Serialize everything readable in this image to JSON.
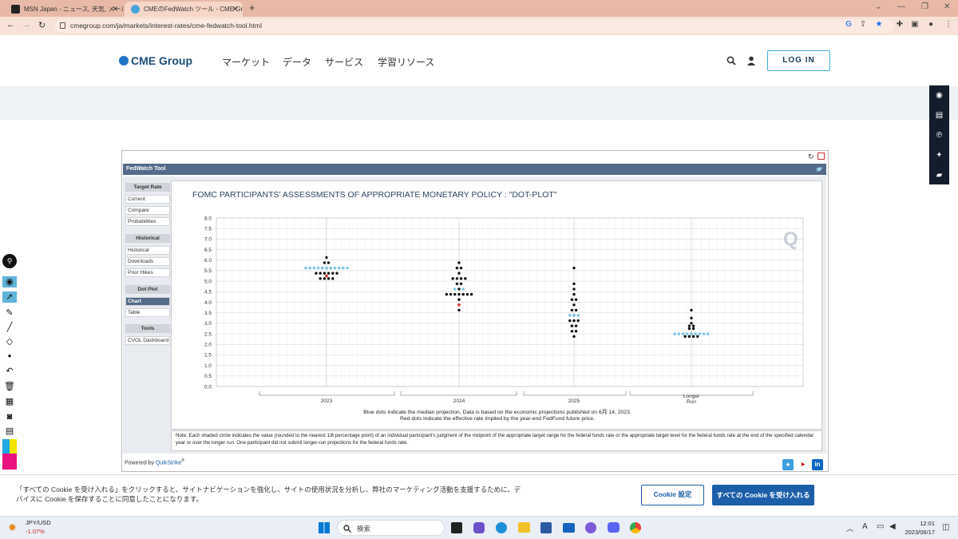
{
  "browser": {
    "tabs": [
      {
        "title": "MSN Japan - ニュース, 天気, メール（"
      },
      {
        "title": "CMEのFedWatch ツール - CME Gro"
      }
    ],
    "new_tab": "+",
    "url": "cmegroup.com/ja/markets/interest-rates/cme-fedwatch-tool.html"
  },
  "site": {
    "logo": "CME Group",
    "nav": [
      "マーケット",
      "データ",
      "サービス",
      "学習リソース"
    ],
    "login": "LOG IN"
  },
  "tool": {
    "header": "FedWatch Tool",
    "sidebar": {
      "target_rate": {
        "heading": "Target Rate",
        "items": [
          "Current",
          "Compare",
          "Probabilities"
        ]
      },
      "historical": {
        "heading": "Historical",
        "items": [
          "Historical",
          "Downloads",
          "Prior Hikes"
        ]
      },
      "dot_plot": {
        "heading": "Dot Plot",
        "items": [
          "Chart",
          "Table"
        ]
      },
      "tools": {
        "heading": "Tools",
        "items": [
          "CVOL Dashboard"
        ]
      }
    },
    "powered_by": "Powered by",
    "powered_brand": "QuikStrike",
    "powered_reg": "®",
    "note": "Note: Each shaded circle indicates the value (rounded to the nearest 1/8 percentage point) of an individual participant's judgment of the midpoint of the appropriate target range for the federal funds rate or the appropriate target level for the federal funds rate at the end of the specified calendar year or over the longer run. One participant did not submit longer-run projections for the federal funds rate."
  },
  "chart_data": {
    "type": "scatter",
    "title": "FOMC PARTICIPANTS' ASSESSMENTS OF APPROPRIATE MONETARY POLICY : \"DOT-PLOT\"",
    "categories": [
      "2023",
      "2024",
      "2025",
      "Longer Run"
    ],
    "y_ticks": [
      "8.0",
      "7.5",
      "7.0",
      "6.5",
      "6.0",
      "5.5",
      "5.0",
      "4.5",
      "4.0",
      "3.5",
      "3.0",
      "2.5",
      "2.0",
      "1.5",
      "1.0",
      "0.5",
      "0.0"
    ],
    "ylim": [
      0,
      8
    ],
    "grid": true,
    "caption_line1": "Blue dots indicate the median projection. Data is based on the economic projections published on 6月 14, 2023.",
    "caption_line2": "Red dots indicate the effective rate implied by the year-end FedFund future price.",
    "colors": {
      "participant": "#111111",
      "median": "#7ec7e3",
      "effective": "#d9342b"
    },
    "participants": [
      {
        "category": "2023",
        "dots": [
          [
            6.125,
            1
          ],
          [
            5.875,
            2
          ],
          [
            5.625,
            3
          ],
          [
            5.375,
            6
          ],
          [
            5.125,
            4
          ]
        ]
      },
      {
        "category": "2024",
        "dots": [
          [
            5.875,
            1
          ],
          [
            5.625,
            2
          ],
          [
            5.375,
            1
          ],
          [
            5.125,
            4
          ],
          [
            4.875,
            2
          ],
          [
            4.625,
            1
          ],
          [
            4.375,
            7
          ],
          [
            4.125,
            1
          ],
          [
            3.875,
            1
          ],
          [
            3.625,
            1
          ]
        ]
      },
      {
        "category": "2025",
        "dots": [
          [
            5.625,
            1
          ],
          [
            4.875,
            1
          ],
          [
            4.625,
            1
          ],
          [
            4.375,
            1
          ],
          [
            4.125,
            2
          ],
          [
            3.875,
            1
          ],
          [
            3.625,
            2
          ],
          [
            3.375,
            1
          ],
          [
            3.125,
            3
          ],
          [
            2.875,
            2
          ],
          [
            2.625,
            2
          ],
          [
            2.375,
            1
          ]
        ]
      },
      {
        "category": "Longer Run",
        "dots": [
          [
            3.625,
            1
          ],
          [
            3.25,
            1
          ],
          [
            3.0,
            1
          ],
          [
            2.875,
            2
          ],
          [
            2.75,
            2
          ],
          [
            2.5,
            1
          ],
          [
            2.375,
            4
          ]
        ]
      }
    ],
    "median": [
      {
        "category": "2023",
        "value": 5.625
      },
      {
        "category": "2024",
        "value": 4.625
      },
      {
        "category": "2025",
        "value": 3.375
      },
      {
        "category": "Longer Run",
        "value": 2.5
      }
    ],
    "effective": [
      {
        "category": "2023",
        "value": 5.25
      },
      {
        "category": "2024",
        "value": 3.875
      }
    ]
  },
  "cookie": {
    "text": "「すべての Cookie を受け入れる」をクリックすると、サイトナビゲーションを強化し、サイトの使用状況を分析し、弊社のマーケティング活動を支援するために、デバイスに Cookie を保存することに同意したことになります。",
    "settings": "Cookie 設定",
    "accept_all": "すべての Cookie を受け入れる"
  },
  "taskbar": {
    "ticker_symbol": "JPY/USD",
    "ticker_change": "-1.07%",
    "search": "検索",
    "ime": "A",
    "time": "12:01",
    "date": "2023/06/17"
  }
}
